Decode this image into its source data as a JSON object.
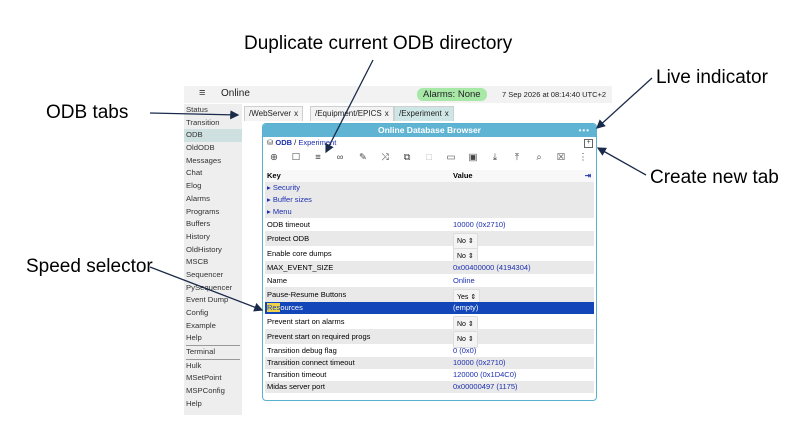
{
  "annotations": {
    "duplicate": "Duplicate current ODB directory",
    "tabs": "ODB tabs",
    "live": "Live indicator",
    "create_tab": "Create new tab",
    "speed": "Speed selector"
  },
  "topbar": {
    "status": "Online",
    "alarms": "Alarms: None",
    "clock": "7 Sep 2026 at 08:14:40 UTC+2"
  },
  "sidebar": {
    "items": [
      "Status",
      "Transition",
      "ODB",
      "OldODB",
      "Messages",
      "Chat",
      "Elog",
      "Alarms",
      "Programs",
      "Buffers",
      "History",
      "OldHistory",
      "MSCB",
      "Sequencer",
      "PySequencer",
      "Event Dump",
      "Config",
      "Example",
      "Help"
    ],
    "active": "ODB",
    "section2": [
      "Terminal"
    ],
    "section3": [
      "Hulk",
      "MSetPoint",
      "MSPConfig",
      "Help"
    ]
  },
  "tabs": [
    {
      "label": "/WebServer",
      "close": "x"
    },
    {
      "label": "/Equipment/EPICS",
      "close": "x"
    },
    {
      "label": "/Experiment",
      "close": "x",
      "active": true
    }
  ],
  "panel": {
    "title": "Online Database Browser",
    "live_indicator": "•••",
    "path_root": "ODB",
    "path_sep": "/",
    "path_dir": "Experiment",
    "new_tab_glyph": "+",
    "toolbar_icons": [
      "new-key-icon",
      "new-folder-icon",
      "duplicate-directory-icon",
      "link-icon",
      "rename-icon",
      "move-icon",
      "copy-icon",
      "paste-icon",
      "open-folder-icon",
      "save-icon",
      "download-icon",
      "upload-icon",
      "search-icon",
      "delete-icon",
      "more-icon"
    ],
    "col_key": "Key",
    "col_value": "Value",
    "collapse_glyph": "⇥",
    "rows": [
      {
        "key": "▸ Security",
        "value": "",
        "type": "grp"
      },
      {
        "key": "▸ Buffer sizes",
        "value": "",
        "type": "grp"
      },
      {
        "key": "▸ Menu",
        "value": "",
        "type": "grp"
      },
      {
        "key": "ODB timeout",
        "value": "10000 (0x2710)",
        "type": "link"
      },
      {
        "key": "Protect ODB",
        "value": "No",
        "type": "select"
      },
      {
        "key": "Enable core dumps",
        "value": "No",
        "type": "select"
      },
      {
        "key": "MAX_EVENT_SIZE",
        "value": "0x00400000 (4194304)",
        "type": "link"
      },
      {
        "key": "Name",
        "value": "Online",
        "type": "link"
      },
      {
        "key": "Pause-Resume Buttons",
        "value": "Yes",
        "type": "select"
      },
      {
        "key_hl": "Res",
        "key_rest": "ources",
        "key": "Resources",
        "value": "(empty)",
        "type": "sel"
      },
      {
        "key": "Prevent start on alarms",
        "value": "No",
        "type": "select"
      },
      {
        "key": "Prevent start on required progs",
        "value": "No",
        "type": "select"
      },
      {
        "key": "Transition debug flag",
        "value": "0 (0x0)",
        "type": "link"
      },
      {
        "key": "Transition connect timeout",
        "value": "10000 (0x2710)",
        "type": "link"
      },
      {
        "key": "Transition timeout",
        "value": "120000 (0x1D4C0)",
        "type": "link"
      },
      {
        "key": "Midas server port",
        "value": "0x00000497 (1175)",
        "type": "link"
      }
    ]
  }
}
